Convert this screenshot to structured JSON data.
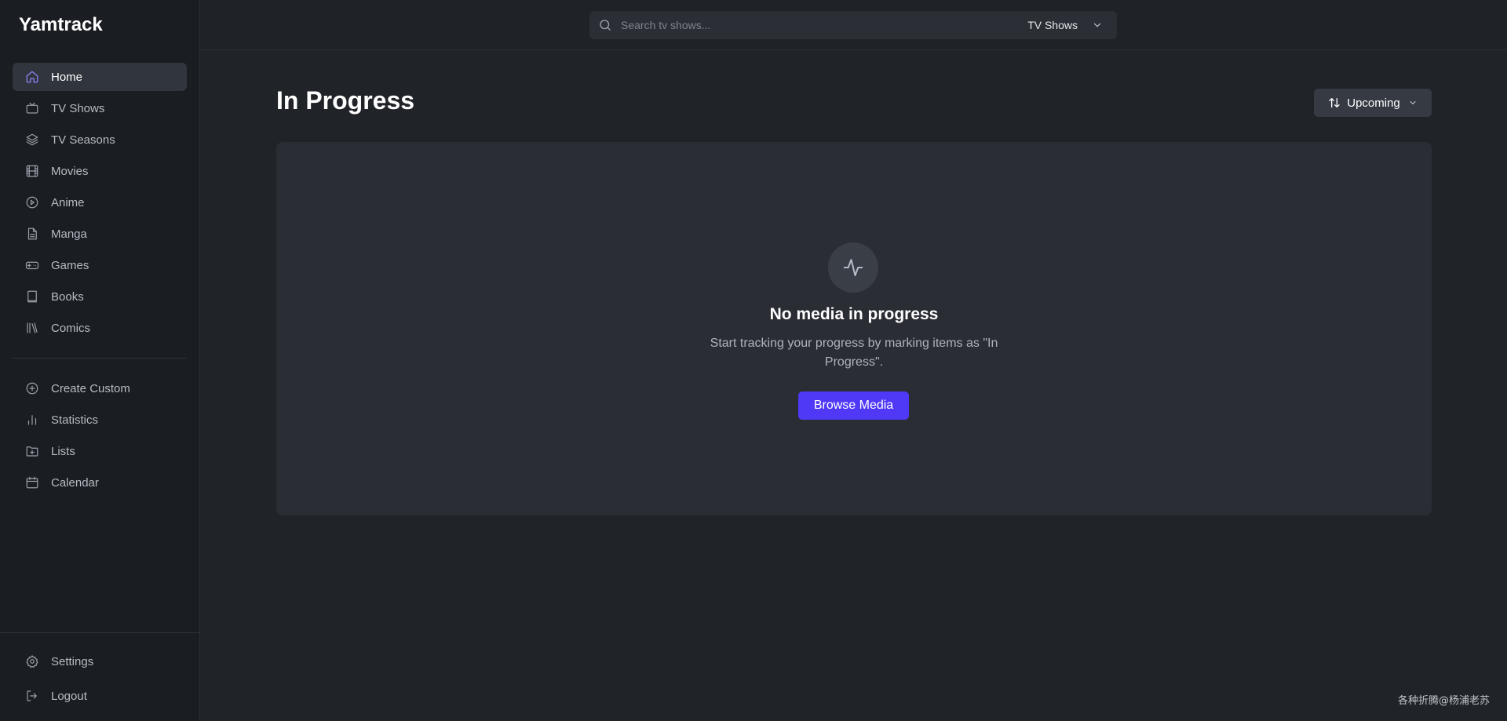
{
  "app": {
    "title": "Yamtrack"
  },
  "sidebar": {
    "items": [
      {
        "label": "Home",
        "icon": "home-icon",
        "active": true
      },
      {
        "label": "TV Shows",
        "icon": "tv-icon"
      },
      {
        "label": "TV Seasons",
        "icon": "layers-icon"
      },
      {
        "label": "Movies",
        "icon": "film-icon"
      },
      {
        "label": "Anime",
        "icon": "play-circle-icon"
      },
      {
        "label": "Manga",
        "icon": "document-icon"
      },
      {
        "label": "Games",
        "icon": "gamepad-icon"
      },
      {
        "label": "Books",
        "icon": "book-icon"
      },
      {
        "label": "Comics",
        "icon": "library-icon"
      }
    ],
    "tools": [
      {
        "label": "Create Custom",
        "icon": "plus-circle-icon"
      },
      {
        "label": "Statistics",
        "icon": "bar-chart-icon"
      },
      {
        "label": "Lists",
        "icon": "folder-plus-icon"
      },
      {
        "label": "Calendar",
        "icon": "calendar-icon"
      }
    ],
    "bottom": [
      {
        "label": "Settings",
        "icon": "gear-icon"
      },
      {
        "label": "Logout",
        "icon": "logout-icon"
      }
    ]
  },
  "search": {
    "placeholder": "Search tv shows...",
    "value": "",
    "media_type": "TV Shows"
  },
  "main": {
    "title": "In Progress",
    "sort_label": "Upcoming",
    "empty": {
      "icon": "activity-icon",
      "title": "No media in progress",
      "description": "Start tracking your progress by marking items as \"In Progress\".",
      "button_label": "Browse Media"
    }
  },
  "watermark": "各种折腾@杨浦老苏",
  "colors": {
    "accent": "#4f39f6",
    "active_icon": "#8b87ff",
    "background": "#202328",
    "sidebar": "#1a1d21",
    "panel": "#2a2d34"
  }
}
